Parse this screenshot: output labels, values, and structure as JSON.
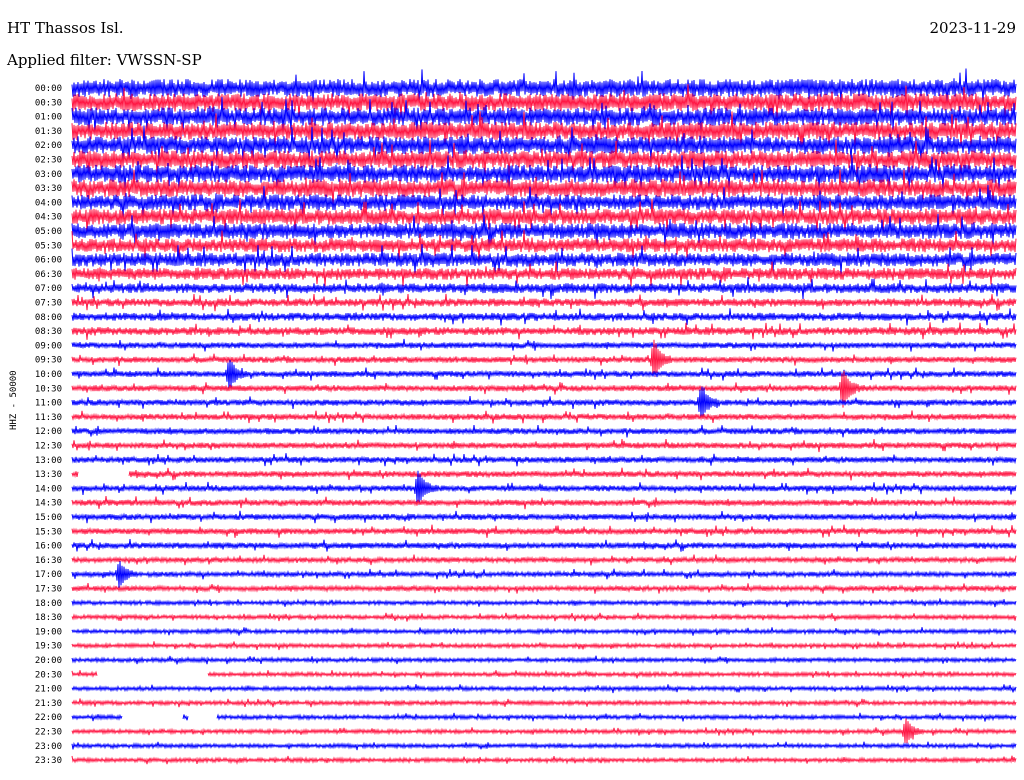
{
  "header": {
    "station": "HT Thassos Isl.",
    "date": "2023-11-29",
    "filter": "Applied filter: VWSSN-SP"
  },
  "channel_label": "HHZ - 50000",
  "colors": {
    "odd_trace": "#0000ff",
    "even_trace": "#ff1744"
  },
  "chart_data": {
    "type": "line",
    "title": "",
    "row_labels": [
      "00:00",
      "00:30",
      "01:00",
      "01:30",
      "02:00",
      "02:30",
      "03:00",
      "03:30",
      "04:00",
      "04:30",
      "05:00",
      "05:30",
      "06:00",
      "06:30",
      "07:00",
      "07:30",
      "08:00",
      "08:30",
      "09:00",
      "09:30",
      "10:00",
      "10:30",
      "11:00",
      "11:30",
      "12:00",
      "12:30",
      "13:00",
      "13:30",
      "14:00",
      "14:30",
      "15:00",
      "15:30",
      "16:00",
      "16:30",
      "17:00",
      "17:30",
      "18:00",
      "18:30",
      "19:00",
      "19:30",
      "20:00",
      "20:30",
      "21:00",
      "21:30",
      "22:00",
      "22:30",
      "23:00",
      "23:30"
    ],
    "row_duration_minutes": 30,
    "noise_level": [
      9,
      9,
      9,
      9,
      9,
      9,
      9,
      9,
      8,
      8,
      8,
      7,
      7,
      6,
      5,
      4,
      4,
      4,
      3,
      3,
      3,
      3,
      3,
      3,
      3,
      3,
      3,
      3,
      3,
      3,
      3,
      3,
      3,
      2.5,
      2.5,
      2.5,
      2,
      2,
      2,
      2,
      2,
      2,
      2,
      2,
      2,
      2,
      2,
      2
    ],
    "events": [
      {
        "row": "09:30",
        "minute": 18.5,
        "amplitude": 18
      },
      {
        "row": "10:00",
        "minute": 5.0,
        "amplitude": 14
      },
      {
        "row": "10:30",
        "minute": 24.5,
        "amplitude": 18
      },
      {
        "row": "11:00",
        "minute": 20.0,
        "amplitude": 15
      },
      {
        "row": "14:00",
        "minute": 11.0,
        "amplitude": 16
      },
      {
        "row": "17:00",
        "minute": 1.5,
        "amplitude": 12
      },
      {
        "row": "22:30",
        "minute": 26.5,
        "amplitude": 12
      }
    ],
    "gaps": [
      {
        "row": "13:30",
        "start_minute": 0.2,
        "end_minute": 1.8
      },
      {
        "row": "20:30",
        "start_minute": 0.8,
        "end_minute": 4.3
      },
      {
        "row": "22:00",
        "start_minute": 1.6,
        "end_minute": 3.5
      },
      {
        "row": "22:00",
        "start_minute": 3.7,
        "end_minute": 4.6
      }
    ]
  }
}
